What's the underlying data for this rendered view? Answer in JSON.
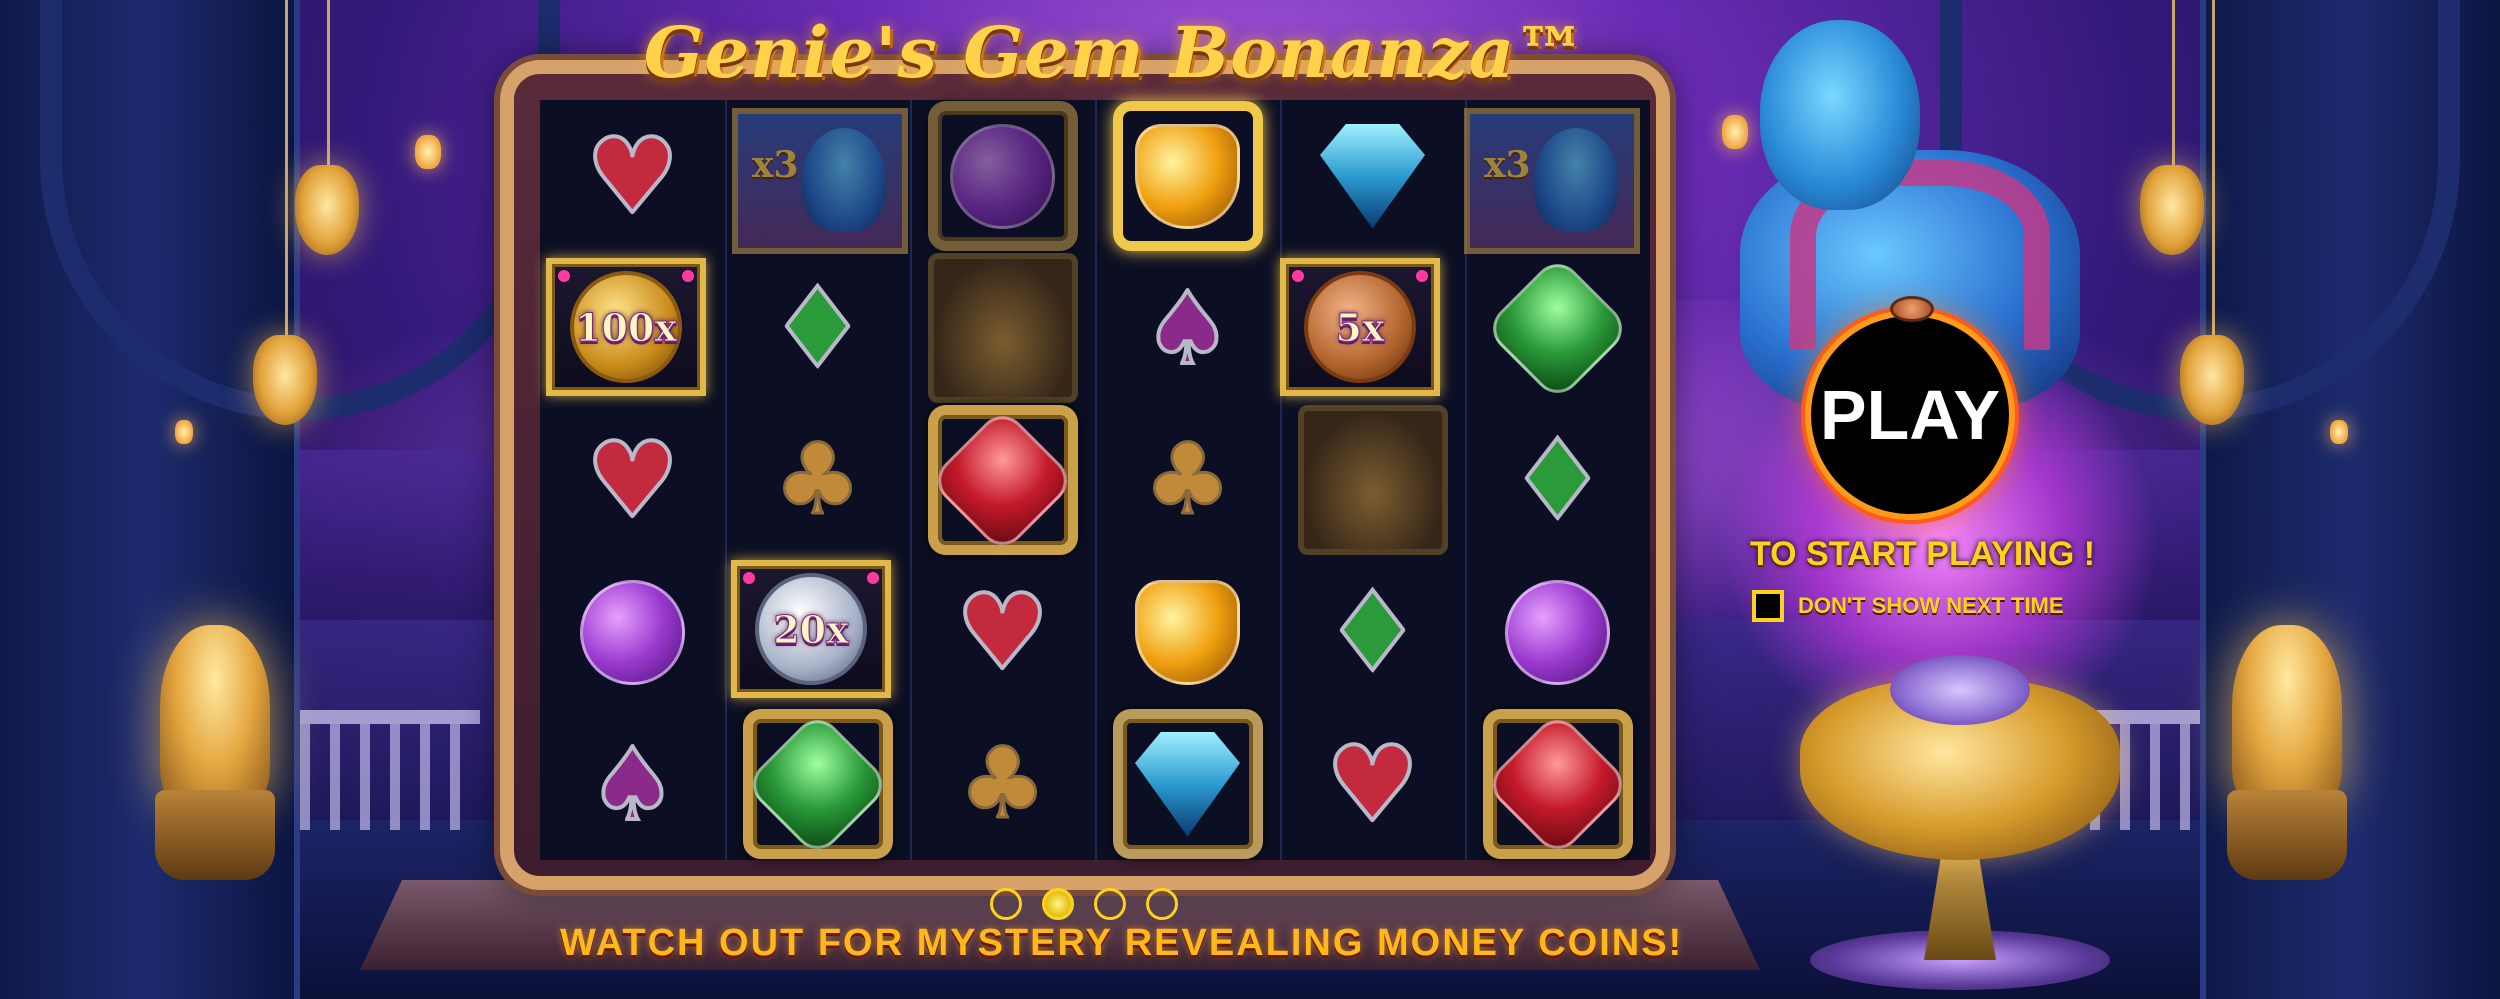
{
  "game": {
    "title": "Genie's Gem Bonanza™"
  },
  "reels": {
    "coins": [
      {
        "value": "100x",
        "kind": "gold"
      },
      {
        "value": "5x",
        "kind": "bronze"
      },
      {
        "value": "20x",
        "kind": "silver"
      }
    ],
    "multipliers": [
      {
        "value": "x3"
      },
      {
        "value": "x3"
      }
    ]
  },
  "intro": {
    "play_label": "PLAY",
    "start_text": "TO START PLAYING !",
    "dont_show_label": "DON'T SHOW NEXT TIME",
    "dont_show_checked": false
  },
  "footer": {
    "pages": 4,
    "active_page": 2,
    "promo_text": "WATCH OUT FOR MYSTERY REVEALING MONEY COINS!"
  },
  "colors": {
    "accent_gold": "#ffd21a",
    "play_ring": "#ff9a1a",
    "background_purple": "#6a2bb5"
  }
}
